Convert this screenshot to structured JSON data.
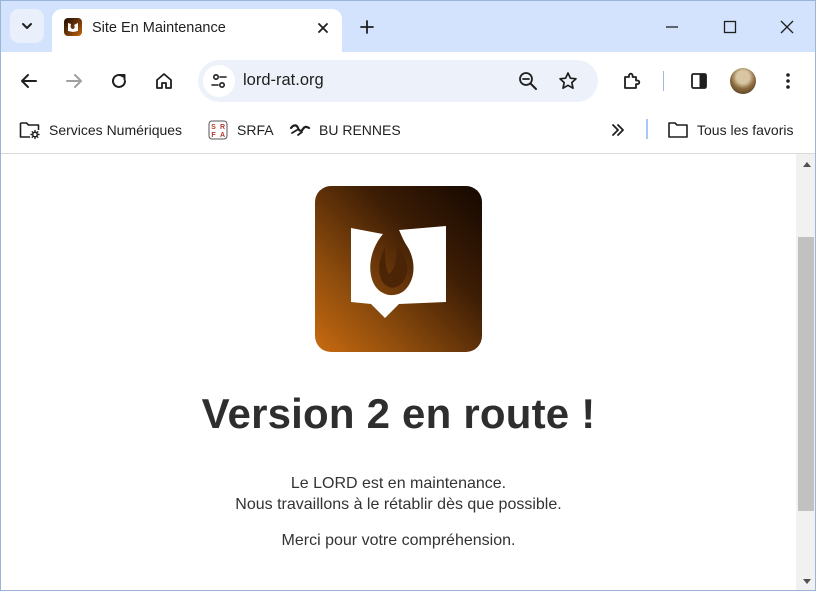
{
  "browser": {
    "tab": {
      "title": "Site En Maintenance"
    },
    "address_bar": {
      "url": "lord-rat.org"
    },
    "bookmarks": [
      {
        "label": "Services Numériques",
        "icon": "folder-settings-icon"
      },
      {
        "label": "SRFA",
        "icon": "srfa-logo-icon"
      },
      {
        "label": "BU RENNES",
        "icon": "bu-rennes-logo-icon"
      }
    ],
    "all_bookmarks": {
      "label": "Tous les favoris"
    },
    "srfa_letters": [
      "S",
      "R",
      "F",
      "A"
    ]
  },
  "page": {
    "headline": "Version 2 en route !",
    "message_line1": "Le LORD est en maintenance.",
    "message_line2": "Nous travaillons à le rétablir dès que possible.",
    "thanks": "Merci pour votre compréhension."
  },
  "colors": {
    "tab_strip": "#d3e3fd",
    "logo_dark": "#150800",
    "logo_orange": "#c96b10",
    "headline": "#2e2e2e"
  }
}
